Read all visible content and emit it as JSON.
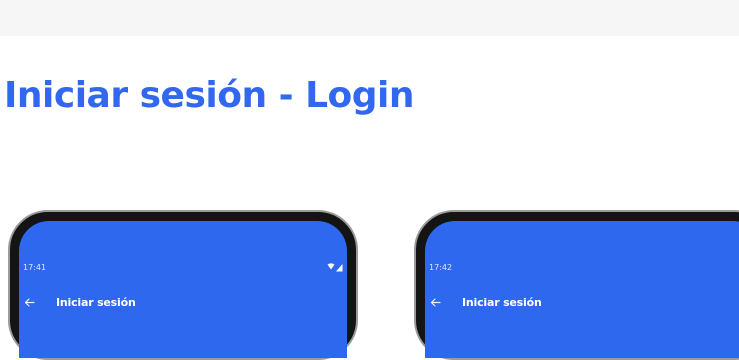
{
  "page": {
    "title": "Iniciar sesión - Login"
  },
  "phones": [
    {
      "status_time": "17:41",
      "appbar_title": "Iniciar sesión"
    },
    {
      "status_time": "17:42",
      "appbar_title": "Iniciar sesión"
    }
  ],
  "colors": {
    "title_blue": "#3267f0",
    "app_blue": "#2e68ee",
    "device_frame": "#141414",
    "top_band": "#f6f6f7"
  },
  "icons": {
    "back": "arrow-left-icon",
    "wifi": "wifi-icon",
    "signal": "cell-signal-icon"
  }
}
